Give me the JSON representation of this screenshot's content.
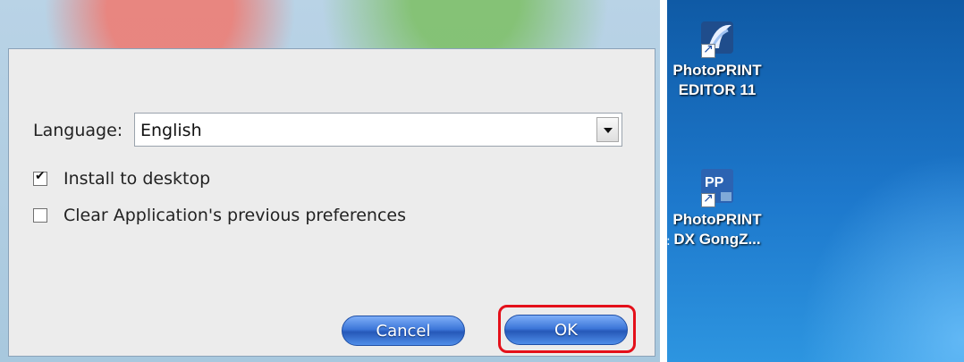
{
  "dialog": {
    "language_label": "Language:",
    "language_value": "English",
    "checkboxes": [
      {
        "label": "Install to desktop",
        "checked": true
      },
      {
        "label": "Clear Application's previous preferences",
        "checked": false
      }
    ],
    "cancel_label": "Cancel",
    "ok_label": "OK"
  },
  "desktop": {
    "icons": [
      {
        "line1": "PhotoPRINT",
        "line2": "EDITOR 11",
        "icon": "photoprint-editor-icon"
      },
      {
        "line1": "PhotoPRINT",
        "line2": "DX GongZ...",
        "icon": "photoprint-dx-icon"
      }
    ]
  },
  "colors": {
    "highlight": "#e4101a",
    "button_blue": "#3d77d9"
  }
}
